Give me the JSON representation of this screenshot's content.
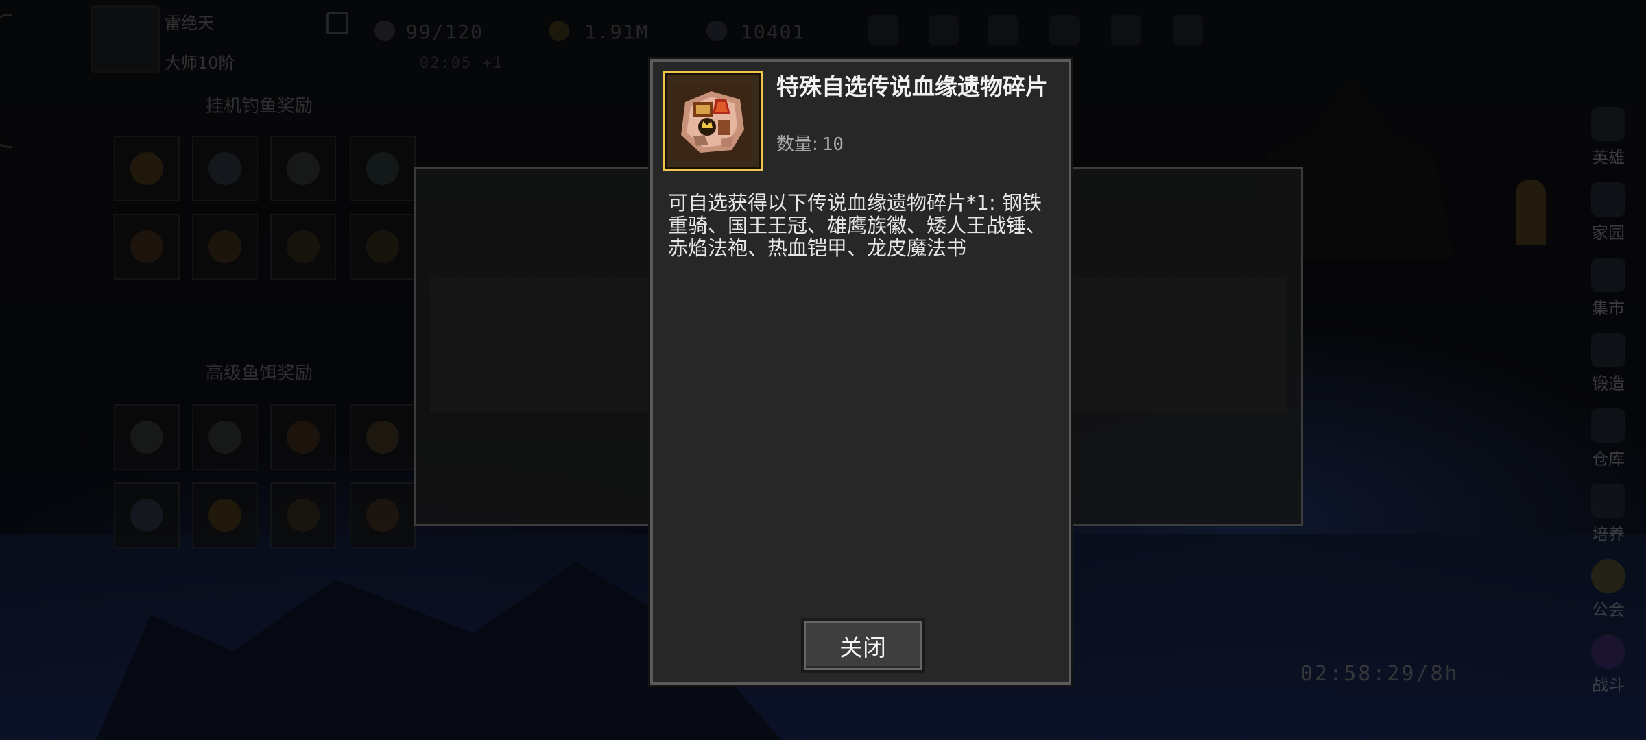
{
  "player": {
    "name": "雷绝天",
    "rank": "大师10阶"
  },
  "hud": {
    "energy": "99/120",
    "energy_timer": "02:05 +1",
    "gold": "1.91M",
    "gems": "10401"
  },
  "rewards": {
    "idle_title": "挂机钓鱼奖励",
    "bait_title": "高级鱼饵奖励"
  },
  "sidebar": {
    "items": [
      {
        "label": "英雄"
      },
      {
        "label": "家园"
      },
      {
        "label": "集市"
      },
      {
        "label": "锻造"
      },
      {
        "label": "仓库"
      },
      {
        "label": "培养"
      },
      {
        "label": "公会"
      },
      {
        "label": "战斗"
      }
    ]
  },
  "timer": "02:58:29/8h",
  "dialog": {
    "title": "特殊自选传说血缘遗物碎片",
    "qty_label": "数量:",
    "qty_value": "10",
    "description": "可自选获得以下传说血缘遗物碎片*1: 钢铁重骑、国王王冠、雄鹰族徽、矮人王战锤、赤焰法袍、热血铠甲、龙皮魔法书",
    "close_label": "关闭",
    "frame_color": "#f0c64a"
  }
}
